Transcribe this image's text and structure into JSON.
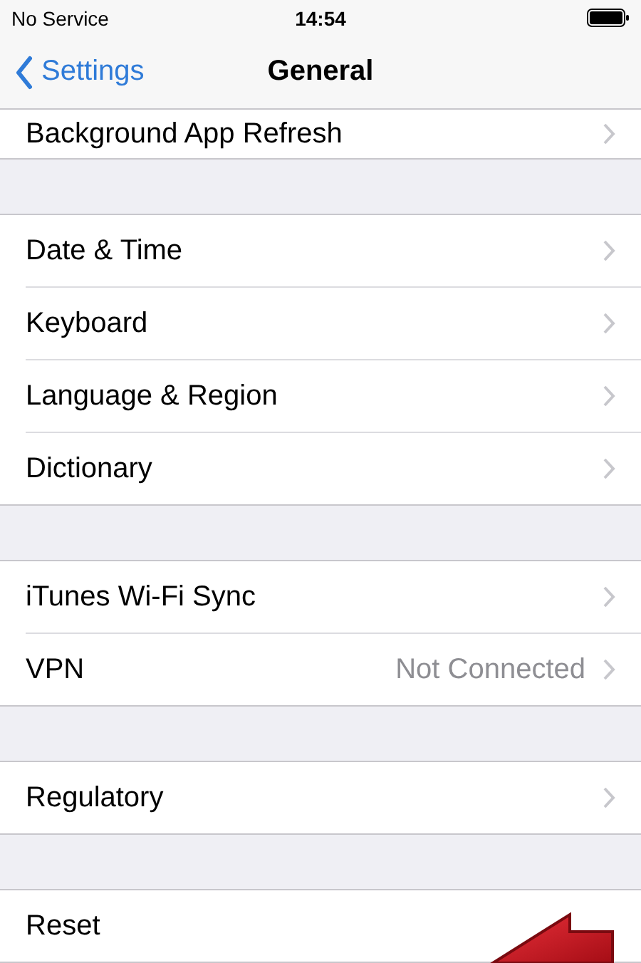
{
  "status_bar": {
    "carrier": "No Service",
    "time": "14:54"
  },
  "nav": {
    "back": "Settings",
    "title": "General"
  },
  "groups": [
    {
      "rows": [
        {
          "label": "Background App Refresh"
        }
      ]
    },
    {
      "rows": [
        {
          "label": "Date & Time"
        },
        {
          "label": "Keyboard"
        },
        {
          "label": "Language & Region"
        },
        {
          "label": "Dictionary"
        }
      ]
    },
    {
      "rows": [
        {
          "label": "iTunes Wi-Fi Sync"
        },
        {
          "label": "VPN",
          "value": "Not Connected"
        }
      ]
    },
    {
      "rows": [
        {
          "label": "Regulatory"
        }
      ]
    },
    {
      "rows": [
        {
          "label": "Reset",
          "chevron": false
        }
      ]
    }
  ],
  "annotation": {
    "kind": "arrow"
  }
}
